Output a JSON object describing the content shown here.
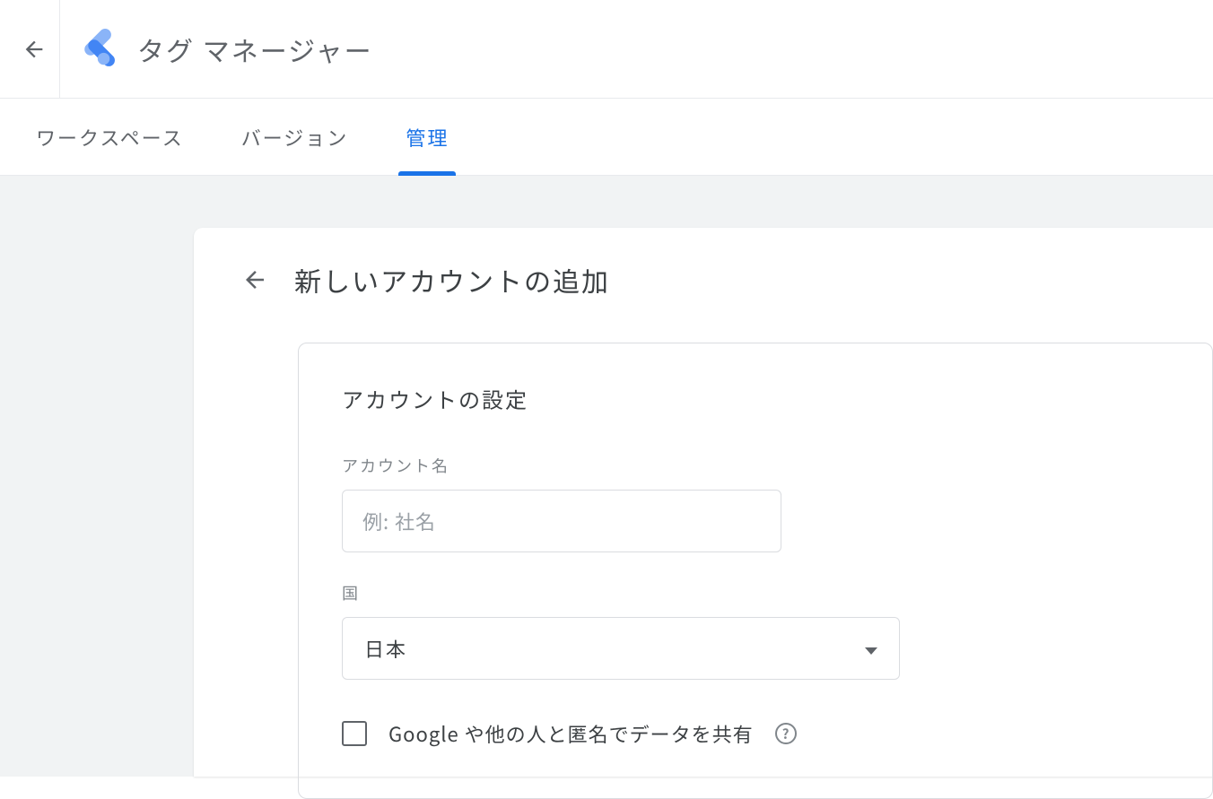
{
  "header": {
    "app_title": "タグ マネージャー"
  },
  "tabs": {
    "workspace": "ワークスペース",
    "version": "バージョン",
    "admin": "管理"
  },
  "card": {
    "title": "新しいアカウントの追加"
  },
  "settings": {
    "section_title": "アカウントの設定",
    "account_name_label": "アカウント名",
    "account_name_placeholder": "例: 社名",
    "country_label": "国",
    "country_value": "日本",
    "checkbox_label": "Google や他の人と匿名でデータを共有"
  }
}
